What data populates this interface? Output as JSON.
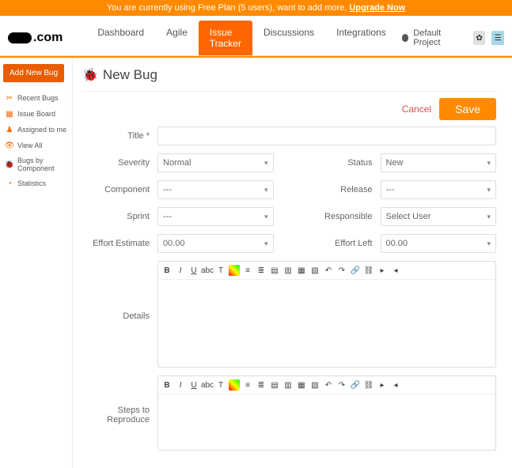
{
  "banner": {
    "text": "You are currently using Free Plan (5 users), want to add more, ",
    "link": "Upgrade Now"
  },
  "logo": {
    "suffix": ".com"
  },
  "nav": {
    "dashboard": "Dashboard",
    "agile": "Agile",
    "issue_tracker": "Issue Tracker",
    "discussions": "Discussions",
    "integrations": "Integrations"
  },
  "header_right": {
    "project": "Default Project"
  },
  "sidebar": {
    "add_btn": "Add New Bug",
    "recent": "Recent Bugs",
    "board": "Issue Board",
    "assigned": "Assigned to me",
    "view_all": "View All",
    "by_component": "Bugs by Component",
    "statistics": "Statistics"
  },
  "page": {
    "title": "New Bug"
  },
  "actions": {
    "cancel": "Cancel",
    "save": "Save"
  },
  "form": {
    "title_label": "Title *",
    "severity_label": "Severity",
    "severity_value": "Normal",
    "status_label": "Status",
    "status_value": "New",
    "component_label": "Component",
    "component_value": "---",
    "release_label": "Release",
    "release_value": "---",
    "sprint_label": "Sprint",
    "sprint_value": "---",
    "responsible_label": "Responsible",
    "responsible_value": "Select User",
    "effort_est_label": "Effort Estimate",
    "effort_est_value": "00.00",
    "effort_left_label": "Effort Left",
    "effort_left_value": "00.00",
    "details_label": "Details",
    "steps_label": "Steps to Reproduce"
  }
}
